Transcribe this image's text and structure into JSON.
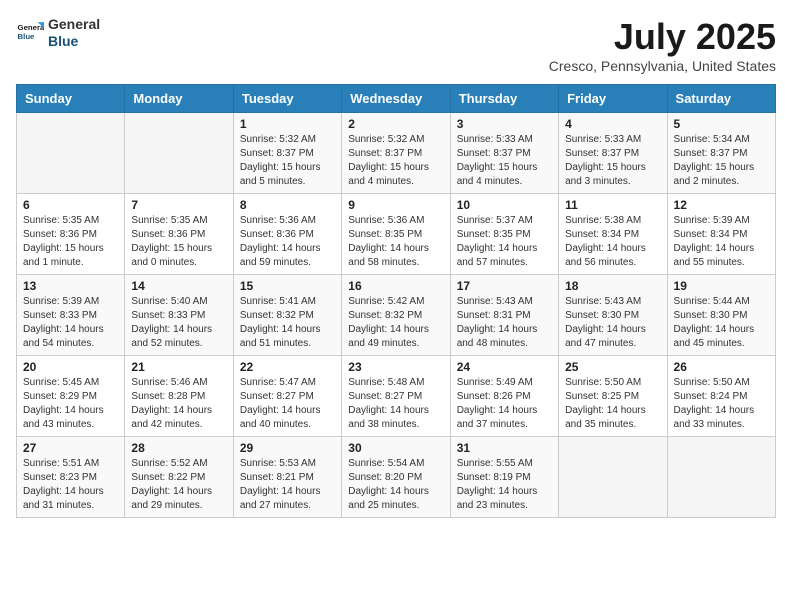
{
  "header": {
    "logo": {
      "general": "General",
      "blue": "Blue"
    },
    "title": "July 2025",
    "location": "Cresco, Pennsylvania, United States"
  },
  "weekdays": [
    "Sunday",
    "Monday",
    "Tuesday",
    "Wednesday",
    "Thursday",
    "Friday",
    "Saturday"
  ],
  "weeks": [
    [
      {
        "day": "",
        "info": ""
      },
      {
        "day": "",
        "info": ""
      },
      {
        "day": "1",
        "info": "Sunrise: 5:32 AM\nSunset: 8:37 PM\nDaylight: 15 hours and 5 minutes."
      },
      {
        "day": "2",
        "info": "Sunrise: 5:32 AM\nSunset: 8:37 PM\nDaylight: 15 hours and 4 minutes."
      },
      {
        "day": "3",
        "info": "Sunrise: 5:33 AM\nSunset: 8:37 PM\nDaylight: 15 hours and 4 minutes."
      },
      {
        "day": "4",
        "info": "Sunrise: 5:33 AM\nSunset: 8:37 PM\nDaylight: 15 hours and 3 minutes."
      },
      {
        "day": "5",
        "info": "Sunrise: 5:34 AM\nSunset: 8:37 PM\nDaylight: 15 hours and 2 minutes."
      }
    ],
    [
      {
        "day": "6",
        "info": "Sunrise: 5:35 AM\nSunset: 8:36 PM\nDaylight: 15 hours and 1 minute."
      },
      {
        "day": "7",
        "info": "Sunrise: 5:35 AM\nSunset: 8:36 PM\nDaylight: 15 hours and 0 minutes."
      },
      {
        "day": "8",
        "info": "Sunrise: 5:36 AM\nSunset: 8:36 PM\nDaylight: 14 hours and 59 minutes."
      },
      {
        "day": "9",
        "info": "Sunrise: 5:36 AM\nSunset: 8:35 PM\nDaylight: 14 hours and 58 minutes."
      },
      {
        "day": "10",
        "info": "Sunrise: 5:37 AM\nSunset: 8:35 PM\nDaylight: 14 hours and 57 minutes."
      },
      {
        "day": "11",
        "info": "Sunrise: 5:38 AM\nSunset: 8:34 PM\nDaylight: 14 hours and 56 minutes."
      },
      {
        "day": "12",
        "info": "Sunrise: 5:39 AM\nSunset: 8:34 PM\nDaylight: 14 hours and 55 minutes."
      }
    ],
    [
      {
        "day": "13",
        "info": "Sunrise: 5:39 AM\nSunset: 8:33 PM\nDaylight: 14 hours and 54 minutes."
      },
      {
        "day": "14",
        "info": "Sunrise: 5:40 AM\nSunset: 8:33 PM\nDaylight: 14 hours and 52 minutes."
      },
      {
        "day": "15",
        "info": "Sunrise: 5:41 AM\nSunset: 8:32 PM\nDaylight: 14 hours and 51 minutes."
      },
      {
        "day": "16",
        "info": "Sunrise: 5:42 AM\nSunset: 8:32 PM\nDaylight: 14 hours and 49 minutes."
      },
      {
        "day": "17",
        "info": "Sunrise: 5:43 AM\nSunset: 8:31 PM\nDaylight: 14 hours and 48 minutes."
      },
      {
        "day": "18",
        "info": "Sunrise: 5:43 AM\nSunset: 8:30 PM\nDaylight: 14 hours and 47 minutes."
      },
      {
        "day": "19",
        "info": "Sunrise: 5:44 AM\nSunset: 8:30 PM\nDaylight: 14 hours and 45 minutes."
      }
    ],
    [
      {
        "day": "20",
        "info": "Sunrise: 5:45 AM\nSunset: 8:29 PM\nDaylight: 14 hours and 43 minutes."
      },
      {
        "day": "21",
        "info": "Sunrise: 5:46 AM\nSunset: 8:28 PM\nDaylight: 14 hours and 42 minutes."
      },
      {
        "day": "22",
        "info": "Sunrise: 5:47 AM\nSunset: 8:27 PM\nDaylight: 14 hours and 40 minutes."
      },
      {
        "day": "23",
        "info": "Sunrise: 5:48 AM\nSunset: 8:27 PM\nDaylight: 14 hours and 38 minutes."
      },
      {
        "day": "24",
        "info": "Sunrise: 5:49 AM\nSunset: 8:26 PM\nDaylight: 14 hours and 37 minutes."
      },
      {
        "day": "25",
        "info": "Sunrise: 5:50 AM\nSunset: 8:25 PM\nDaylight: 14 hours and 35 minutes."
      },
      {
        "day": "26",
        "info": "Sunrise: 5:50 AM\nSunset: 8:24 PM\nDaylight: 14 hours and 33 minutes."
      }
    ],
    [
      {
        "day": "27",
        "info": "Sunrise: 5:51 AM\nSunset: 8:23 PM\nDaylight: 14 hours and 31 minutes."
      },
      {
        "day": "28",
        "info": "Sunrise: 5:52 AM\nSunset: 8:22 PM\nDaylight: 14 hours and 29 minutes."
      },
      {
        "day": "29",
        "info": "Sunrise: 5:53 AM\nSunset: 8:21 PM\nDaylight: 14 hours and 27 minutes."
      },
      {
        "day": "30",
        "info": "Sunrise: 5:54 AM\nSunset: 8:20 PM\nDaylight: 14 hours and 25 minutes."
      },
      {
        "day": "31",
        "info": "Sunrise: 5:55 AM\nSunset: 8:19 PM\nDaylight: 14 hours and 23 minutes."
      },
      {
        "day": "",
        "info": ""
      },
      {
        "day": "",
        "info": ""
      }
    ]
  ]
}
